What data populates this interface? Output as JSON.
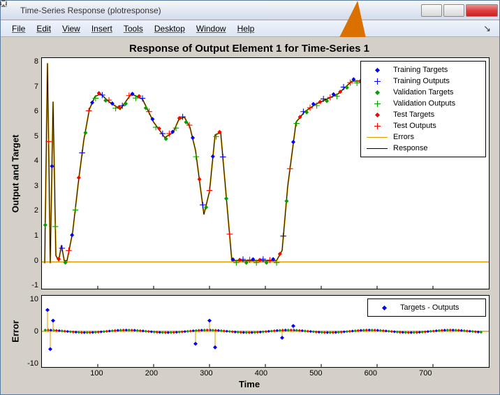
{
  "window": {
    "title": "Time-Series Response (plotresponse)"
  },
  "menu": {
    "file": "File",
    "edit": "Edit",
    "view": "View",
    "insert": "Insert",
    "tools": "Tools",
    "desktop": "Desktop",
    "window": "Window",
    "help": "Help"
  },
  "chart": {
    "title": "Response of Output Element 1 for Time-Series 1",
    "xlabel": "Time",
    "top": {
      "ylabel": "Output and Target",
      "yticks": [
        "8",
        "7",
        "6",
        "5",
        "4",
        "3",
        "2",
        "1",
        "0",
        "-1"
      ],
      "legend": {
        "train_targets": "Training Targets",
        "train_outputs": "Training Outputs",
        "val_targets": "Validation Targets",
        "val_outputs": "Validation Outputs",
        "test_targets": "Test Targets",
        "test_outputs": "Test Outputs",
        "errors": "Errors",
        "response": "Response"
      }
    },
    "bottom": {
      "ylabel": "Error",
      "yticks": [
        "10",
        "0",
        "-10"
      ],
      "legend": {
        "diff": "Targets - Outputs"
      }
    },
    "xticks": [
      "100",
      "200",
      "300",
      "400",
      "500",
      "600",
      "700"
    ]
  },
  "colors": {
    "train": "#0000ff",
    "val": "#00a000",
    "test": "#ff0000",
    "errors": "#e0a000",
    "response": "#000000",
    "figbg": "#d4d0c8"
  },
  "chart_data": {
    "type": "line",
    "panels": [
      {
        "name": "Output and Target",
        "xlim": [
          0,
          800
        ],
        "ylim": [
          -1,
          8
        ],
        "response_series": {
          "x": [
            5,
            10,
            15,
            20,
            25,
            30,
            35,
            40,
            45,
            55,
            65,
            75,
            85,
            95,
            105,
            120,
            140,
            160,
            180,
            200,
            220,
            235,
            245,
            255,
            265,
            275,
            290,
            300,
            310,
            320,
            340,
            380,
            420,
            430,
            440,
            455,
            470,
            490,
            510,
            530,
            555,
            580,
            600,
            620,
            640,
            660,
            680,
            700,
            730,
            760,
            790
          ],
          "y": [
            0.0,
            7.8,
            0.0,
            6.3,
            0.3,
            0.1,
            0.7,
            0.1,
            0.1,
            1.2,
            3.1,
            4.8,
            6.0,
            6.5,
            6.6,
            6.3,
            6.0,
            6.6,
            6.4,
            5.5,
            4.9,
            5.1,
            5.6,
            5.7,
            5.3,
            4.4,
            1.9,
            2.8,
            5.0,
            5.1,
            0.1,
            0.1,
            0.1,
            0.5,
            3.0,
            5.5,
            5.9,
            6.2,
            6.4,
            6.6,
            7.1,
            7.1,
            6.7,
            6.7,
            6.9,
            7.1,
            7.2,
            6.9,
            6.8,
            6.8,
            6.9
          ]
        },
        "marker_sets": [
          "Training Targets",
          "Training Outputs",
          "Validation Targets",
          "Validation Outputs",
          "Test Targets",
          "Test Outputs"
        ],
        "note": "Targets (diamonds) and Outputs (plus) in blue/green/red follow the Response curve closely; Errors line (orange) runs near y≈0 along the x-axis."
      },
      {
        "name": "Error",
        "xlim": [
          0,
          800
        ],
        "ylim": [
          -10,
          10
        ],
        "series": {
          "name": "Targets - Outputs",
          "x": [
            5,
            10,
            15,
            20,
            30,
            50,
            100,
            150,
            200,
            250,
            275,
            300,
            310,
            350,
            400,
            430,
            450,
            500,
            550,
            600,
            650,
            700,
            750,
            790
          ],
          "y": [
            0.5,
            6.0,
            -5.0,
            3.0,
            -0.3,
            0.2,
            -0.1,
            0.3,
            -0.2,
            0.1,
            -3.5,
            3.0,
            -4.5,
            0.1,
            -0.1,
            -1.8,
            1.5,
            0.2,
            -0.3,
            0.1,
            -0.1,
            0.2,
            -0.1,
            0.1
          ]
        }
      }
    ],
    "xlabel": "Time"
  }
}
